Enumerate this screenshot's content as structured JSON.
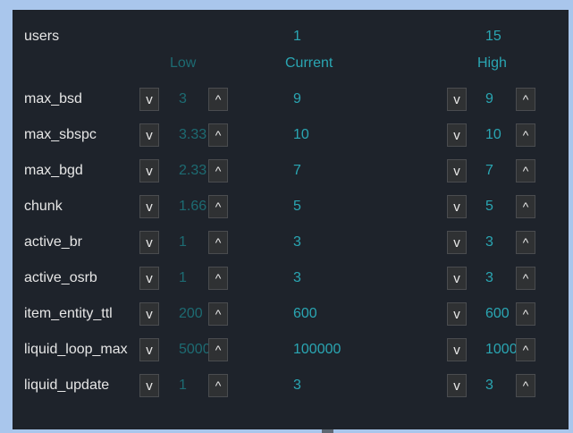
{
  "users": {
    "label": "users",
    "low": "1",
    "high": "15"
  },
  "columns": {
    "low": "Low",
    "current": "Current",
    "high": "High"
  },
  "buttons": {
    "down": "v",
    "up": "^"
  },
  "rows": [
    {
      "name": "max_bsd",
      "low": "3",
      "current": "9",
      "high": "9"
    },
    {
      "name": "max_sbspc",
      "low": "3.33",
      "current": "10",
      "high": "10"
    },
    {
      "name": "max_bgd",
      "low": "2.33",
      "current": "7",
      "high": "7"
    },
    {
      "name": "chunk",
      "low": "1.66",
      "current": "5",
      "high": "5"
    },
    {
      "name": "active_br",
      "low": "1",
      "current": "3",
      "high": "3"
    },
    {
      "name": "active_osrb",
      "low": "1",
      "current": "3",
      "high": "3"
    },
    {
      "name": "item_entity_ttl",
      "low": "200",
      "current": "600",
      "high": "600"
    },
    {
      "name": "liquid_loop_max",
      "low": "5000",
      "current": "100000",
      "high": "1000"
    },
    {
      "name": "liquid_update",
      "low": "1",
      "current": "3",
      "high": "3"
    }
  ]
}
